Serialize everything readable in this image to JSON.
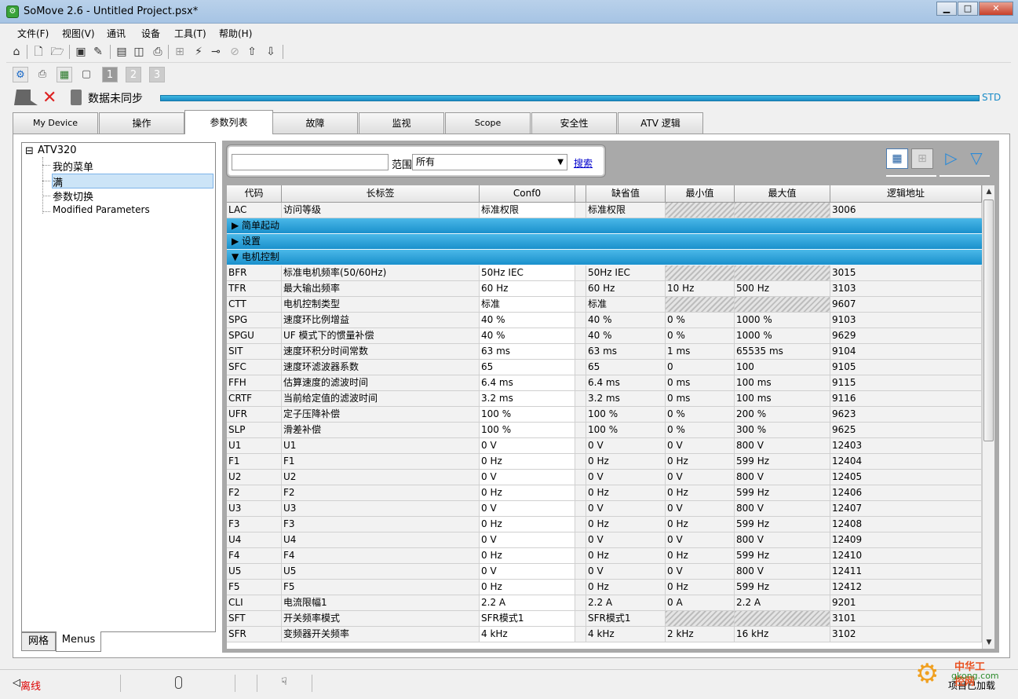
{
  "window": {
    "title": "SoMove 2.6 - Untitled Project.psx*",
    "min": "▁",
    "max": "□",
    "close": "✕"
  },
  "menu": [
    "文件(F)",
    "视图(V)",
    "通讯",
    "设备",
    "工具(T)",
    "帮助(H)"
  ],
  "sync": {
    "status": "数据未同步",
    "mode": "STD"
  },
  "tabs": [
    "My Device",
    "操作",
    "参数列表",
    "故障",
    "监视",
    "Scope",
    "安全性",
    "ATV 逻辑"
  ],
  "tree": {
    "root": "ATV320",
    "items": [
      "我的菜单",
      "满",
      "参数切换",
      "Modified Parameters"
    ]
  },
  "bottom_tabs": [
    "网格",
    "Menus"
  ],
  "search": {
    "value": "",
    "scope_label": "范围",
    "scope_value": "所有",
    "search_link": "搜索"
  },
  "columns": [
    "代码",
    "长标签",
    "Conf0",
    "缺省值",
    "最小值",
    "最大值",
    "逻辑地址"
  ],
  "rows": [
    {
      "type": "row",
      "code": "LAC",
      "label": "访问等级",
      "conf": "标准权限",
      "def": "标准权限",
      "min": "",
      "max": "",
      "addr": "3006",
      "hatch": true
    },
    {
      "type": "group",
      "label": "简单起动",
      "open": false
    },
    {
      "type": "group",
      "label": "设置",
      "open": false
    },
    {
      "type": "group",
      "label": "电机控制",
      "open": true
    },
    {
      "type": "row",
      "code": "BFR",
      "label": "标准电机频率(50/60Hz)",
      "conf": "50Hz IEC",
      "def": "50Hz IEC",
      "min": "",
      "max": "",
      "addr": "3015",
      "hatch": true
    },
    {
      "type": "row",
      "code": "TFR",
      "label": "最大输出频率",
      "conf": "60 Hz",
      "def": "60 Hz",
      "min": "10 Hz",
      "max": "500 Hz",
      "addr": "3103"
    },
    {
      "type": "row",
      "code": "CTT",
      "label": "电机控制类型",
      "conf": "标准",
      "def": "标准",
      "min": "",
      "max": "",
      "addr": "9607",
      "hatch": true
    },
    {
      "type": "row",
      "code": "SPG",
      "label": "速度环比例增益",
      "conf": "40 %",
      "def": "40 %",
      "min": "0 %",
      "max": "1000 %",
      "addr": "9103"
    },
    {
      "type": "row",
      "code": "SPGU",
      "label": "UF 模式下的惯量补偿",
      "conf": "40 %",
      "def": "40 %",
      "min": "0 %",
      "max": "1000 %",
      "addr": "9629"
    },
    {
      "type": "row",
      "code": "SIT",
      "label": "速度环积分时间常数",
      "conf": "63 ms",
      "def": "63 ms",
      "min": "1 ms",
      "max": "65535 ms",
      "addr": "9104"
    },
    {
      "type": "row",
      "code": "SFC",
      "label": "速度环滤波器系数",
      "conf": "65",
      "def": "65",
      "min": "0",
      "max": "100",
      "addr": "9105"
    },
    {
      "type": "row",
      "code": "FFH",
      "label": "估算速度的滤波时间",
      "conf": "6.4 ms",
      "def": "6.4 ms",
      "min": "0 ms",
      "max": "100 ms",
      "addr": "9115"
    },
    {
      "type": "row",
      "code": "CRTF",
      "label": "当前给定值的滤波时间",
      "conf": "3.2 ms",
      "def": "3.2 ms",
      "min": "0 ms",
      "max": "100 ms",
      "addr": "9116"
    },
    {
      "type": "row",
      "code": "UFR",
      "label": "定子压降补偿",
      "conf": "100 %",
      "def": "100 %",
      "min": "0 %",
      "max": "200 %",
      "addr": "9623"
    },
    {
      "type": "row",
      "code": "SLP",
      "label": "滑差补偿",
      "conf": "100 %",
      "def": "100 %",
      "min": "0 %",
      "max": "300 %",
      "addr": "9625"
    },
    {
      "type": "row",
      "code": "U1",
      "label": "U1",
      "conf": "0 V",
      "def": "0 V",
      "min": "0 V",
      "max": "800 V",
      "addr": "12403"
    },
    {
      "type": "row",
      "code": "F1",
      "label": "F1",
      "conf": "0 Hz",
      "def": "0 Hz",
      "min": "0 Hz",
      "max": "599 Hz",
      "addr": "12404"
    },
    {
      "type": "row",
      "code": "U2",
      "label": "U2",
      "conf": "0 V",
      "def": "0 V",
      "min": "0 V",
      "max": "800 V",
      "addr": "12405"
    },
    {
      "type": "row",
      "code": "F2",
      "label": "F2",
      "conf": "0 Hz",
      "def": "0 Hz",
      "min": "0 Hz",
      "max": "599 Hz",
      "addr": "12406"
    },
    {
      "type": "row",
      "code": "U3",
      "label": "U3",
      "conf": "0 V",
      "def": "0 V",
      "min": "0 V",
      "max": "800 V",
      "addr": "12407"
    },
    {
      "type": "row",
      "code": "F3",
      "label": "F3",
      "conf": "0 Hz",
      "def": "0 Hz",
      "min": "0 Hz",
      "max": "599 Hz",
      "addr": "12408"
    },
    {
      "type": "row",
      "code": "U4",
      "label": "U4",
      "conf": "0 V",
      "def": "0 V",
      "min": "0 V",
      "max": "800 V",
      "addr": "12409"
    },
    {
      "type": "row",
      "code": "F4",
      "label": "F4",
      "conf": "0 Hz",
      "def": "0 Hz",
      "min": "0 Hz",
      "max": "599 Hz",
      "addr": "12410"
    },
    {
      "type": "row",
      "code": "U5",
      "label": "U5",
      "conf": "0 V",
      "def": "0 V",
      "min": "0 V",
      "max": "800 V",
      "addr": "12411"
    },
    {
      "type": "row",
      "code": "F5",
      "label": "F5",
      "conf": "0 Hz",
      "def": "0 Hz",
      "min": "0 Hz",
      "max": "599 Hz",
      "addr": "12412"
    },
    {
      "type": "row",
      "code": "CLI",
      "label": "电流限幅1",
      "conf": "2.2 A",
      "def": "2.2 A",
      "min": "0 A",
      "max": "2.2 A",
      "addr": "9201"
    },
    {
      "type": "row",
      "code": "SFT",
      "label": "开关频率模式",
      "conf": "SFR模式1",
      "def": "SFR模式1",
      "min": "",
      "max": "",
      "addr": "3101",
      "hatch": true
    },
    {
      "type": "row",
      "code": "SFR",
      "label": "变频器开关频率",
      "conf": "4 kHz",
      "def": "4 kHz",
      "min": "2 kHz",
      "max": "16 kHz",
      "addr": "3102"
    }
  ],
  "status": {
    "offline": "离线",
    "project": "项目已加载"
  },
  "watermark": {
    "line1": "中华工控网",
    "line2": "gkong.com"
  }
}
